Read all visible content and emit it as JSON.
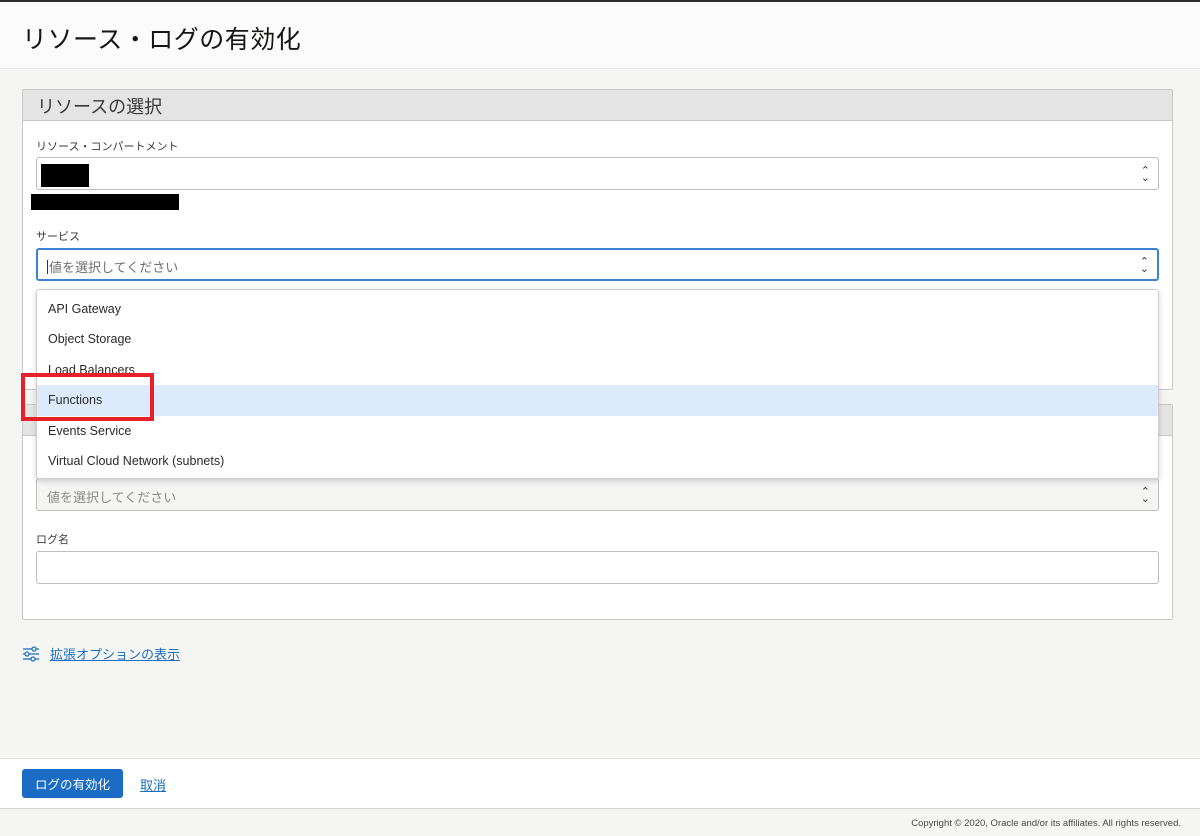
{
  "page": {
    "title": "リソース・ログの有効化"
  },
  "resource_panel": {
    "title": "リソースの選択",
    "compartment_label": "リソース・コンパートメント",
    "service_label": "サービス",
    "service_placeholder": "値を選択してください"
  },
  "service_dropdown": {
    "items": [
      {
        "label": "API Gateway"
      },
      {
        "label": "Object Storage"
      },
      {
        "label": "Load Balancers"
      },
      {
        "label": "Functions"
      },
      {
        "label": "Events Service"
      },
      {
        "label": "Virtual Cloud Network (subnets)"
      }
    ],
    "highlighted_index": 3
  },
  "log_panel": {
    "category_placeholder": "値を選択してください",
    "log_name_label": "ログ名",
    "log_name_value": ""
  },
  "advanced_options": {
    "label": "拡張オプションの表示"
  },
  "actions": {
    "enable_label": "ログの有効化",
    "cancel_label": "取消"
  },
  "footer": {
    "copyright": "Copyright © 2020, Oracle and/or its affiliates. All rights reserved."
  },
  "colors": {
    "primary": "#1b6cc4",
    "link": "#1a6fbf",
    "focus": "#3b82d6",
    "highlight": "#ddeafc",
    "annotation": "#e8202a"
  },
  "icons": {
    "select_caret": "chevron-up-down-icon",
    "advanced_options": "sliders-icon"
  }
}
